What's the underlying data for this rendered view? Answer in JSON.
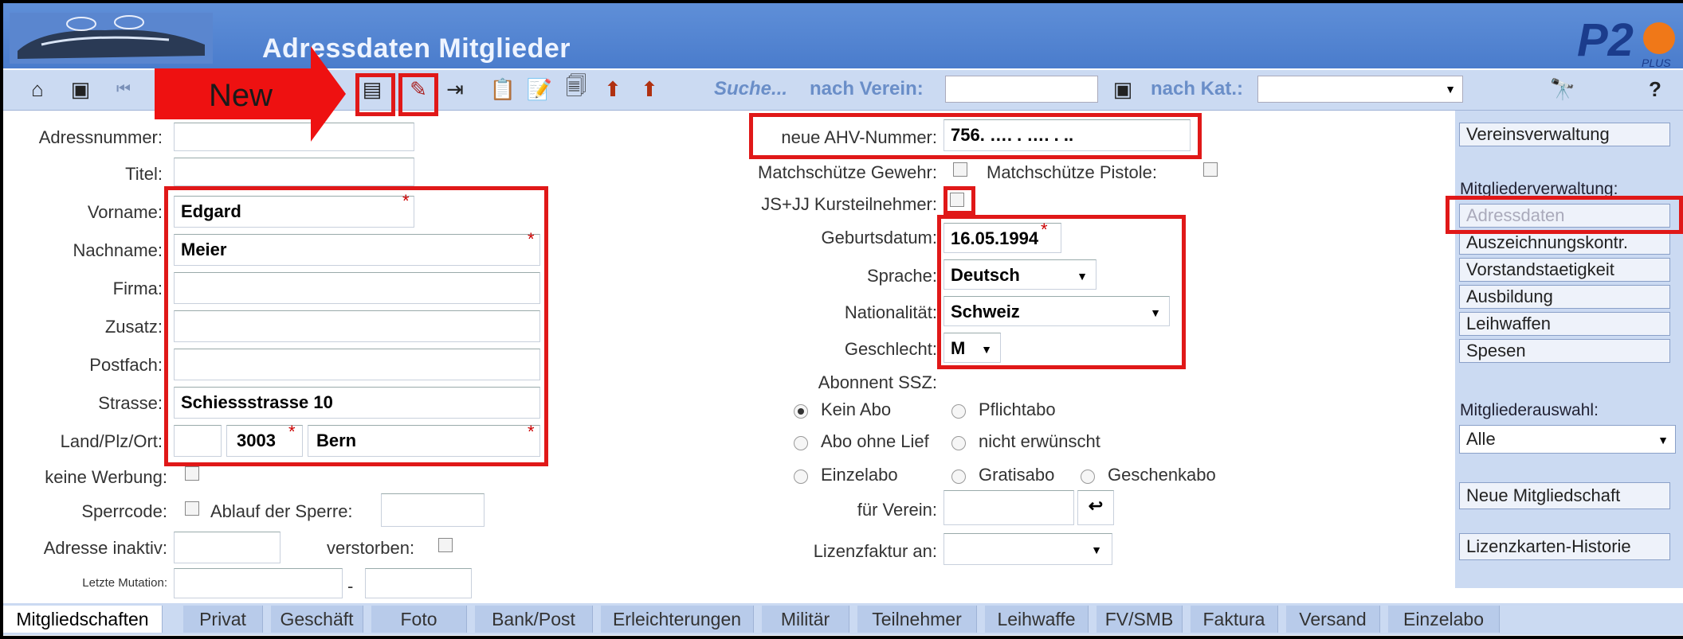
{
  "title": "Adressdaten Mitglieder",
  "toolbar": {
    "search_label": "Suche...",
    "by_club_label": "nach Verein:",
    "by_cat_label": "nach Kat.:",
    "help": "?"
  },
  "annotation": {
    "new_label": "New"
  },
  "form": {
    "adressnummer_label": "Adressnummer:",
    "titel_label": "Titel:",
    "vorname_label": "Vorname:",
    "vorname_value": "Edgard",
    "nachname_label": "Nachname:",
    "nachname_value": "Meier",
    "firma_label": "Firma:",
    "zusatz_label": "Zusatz:",
    "postfach_label": "Postfach:",
    "strasse_label": "Strasse:",
    "strasse_value": "Schiessstrasse 10",
    "land_label": "Land/Plz/Ort:",
    "plz_value": "3003",
    "ort_value": "Bern",
    "keine_werbung_label": "keine Werbung:",
    "sperrcode_label": "Sperrcode:",
    "ablauf_label": "Ablauf der Sperre:",
    "inaktiv_label": "Adresse inaktiv:",
    "verstorben_label": "verstorben:",
    "letzte_mutation_label": "Letzte Mutation:",
    "mutation_sep": "-",
    "ahv_label": "neue AHV-Nummer:",
    "ahv_value": "756. …. . …. . ..",
    "match_gewehr_label": "Matchschütze Gewehr:",
    "match_pistole_label": "Matchschütze Pistole:",
    "jsjj_label": "JS+JJ Kursteilnehmer:",
    "geburtsdatum_label": "Geburtsdatum:",
    "geburtsdatum_value": "16.05.1994",
    "sprache_label": "Sprache:",
    "sprache_value": "Deutsch",
    "nationalitaet_label": "Nationalität:",
    "nationalitaet_value": "Schweiz",
    "geschlecht_label": "Geschlecht:",
    "geschlecht_value": "M",
    "abonnent_label": "Abonnent SSZ:",
    "abo_options": [
      "Kein Abo",
      "Pflichtabo",
      "Abo ohne Lief",
      "nicht erwünscht",
      "Einzelabo",
      "Gratisabo",
      "Geschenkabo"
    ],
    "fuer_verein_label": "für Verein:",
    "lizenzfaktur_label": "Lizenzfaktur an:",
    "required_mark": "*"
  },
  "sidebar": {
    "vereinsverwaltung": "Vereinsverwaltung",
    "mitgliederverwaltung_label": "Mitgliederverwaltung:",
    "items": [
      "Adressdaten",
      "Auszeichnungskontr.",
      "Vorstandstaetigkeit",
      "Ausbildung",
      "Leihwaffen",
      "Spesen"
    ],
    "mitgliederauswahl_label": "Mitgliederauswahl:",
    "mitgliederauswahl_value": "Alle",
    "neue_mitgliedschaft": "Neue Mitgliedschaft",
    "lizenzkarten_historie": "Lizenzkarten-Historie"
  },
  "tabs": [
    "Mitgliedschaften",
    "Privat",
    "Geschäft",
    "Foto",
    "Bank/Post",
    "Erleichterungen",
    "Militär",
    "Teilnehmer",
    "Leihwaffe",
    "FV/SMB",
    "Faktura",
    "Versand",
    "Einzelabo"
  ],
  "colors": {
    "highlight": "#e01818",
    "panel": "#cbdaf2",
    "titlebar": "#4a7ccc"
  }
}
